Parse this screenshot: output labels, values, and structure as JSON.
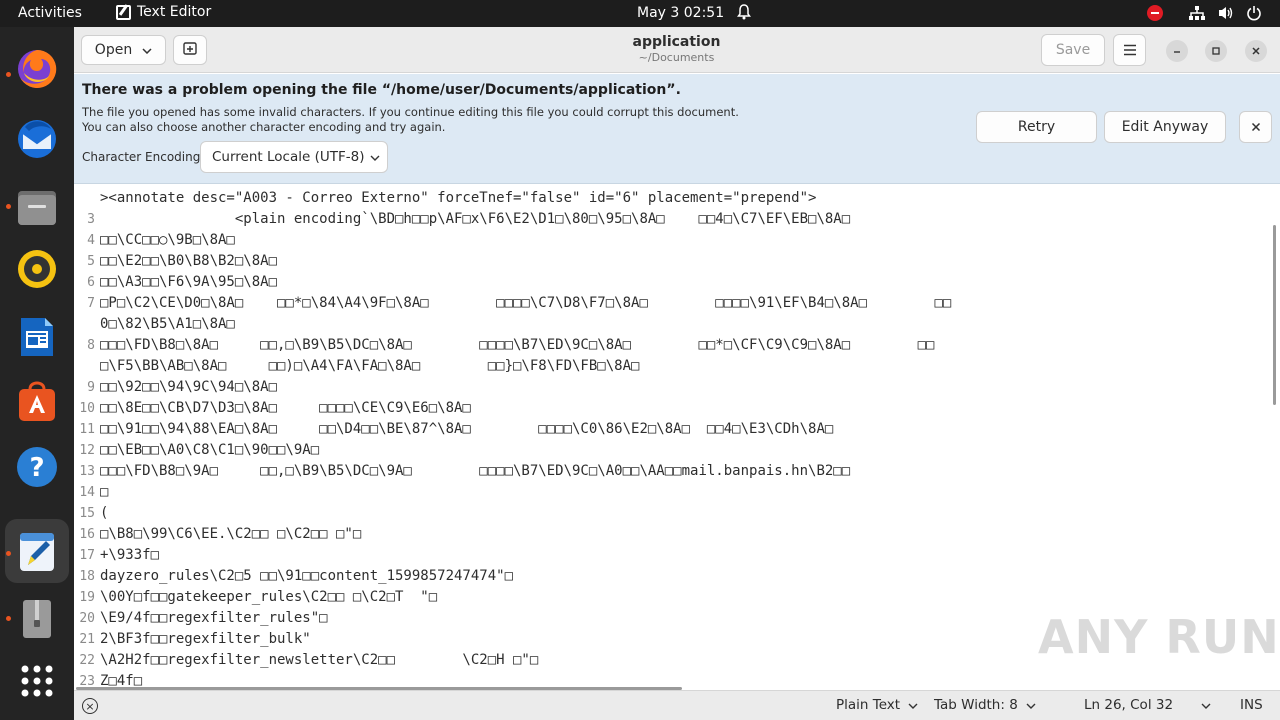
{
  "topbar": {
    "activities": "Activities",
    "app_name": "Text Editor",
    "clock": "May 3  02:51"
  },
  "dock": {
    "items": [
      "firefox",
      "thunderbird",
      "files",
      "rhythmbox",
      "writer",
      "app-center",
      "help",
      "text-editor",
      "archive-manager",
      "show-apps"
    ]
  },
  "window": {
    "title": "application",
    "subtitle": "~/Documents",
    "open_label": "Open",
    "save_label": "Save"
  },
  "infobar": {
    "heading": "There was a problem opening the file “/home/user/Documents/application”.",
    "line1": "The file you opened has some invalid characters. If you continue editing this file you could corrupt this document.",
    "line2": "You can also choose another character encoding and try again.",
    "encoding_label": "Character Encoding:",
    "encoding_value": "Current Locale (UTF-8)",
    "retry_label": "Retry",
    "edit_anyway_label": "Edit Anyway"
  },
  "editor": {
    "lines": [
      {
        "n": "",
        "text": "><annotate desc=\"A003 - Correo Externo\" forceTnef=\"false\" id=\"6\" placement=\"prepend\">"
      },
      {
        "n": "3",
        "text": "                <plain encoding`\\BD□h□□p\\AF□x\\F6\\E2\\D1□\\80□\\95□\\8A□    □□4□\\C7\\EF\\EB□\\8A□"
      },
      {
        "n": "4",
        "text": "□□\\CC□□○\\9B□\\8A□"
      },
      {
        "n": "5",
        "text": "□□\\E2□□\\B0\\B8\\B2□\\8A□"
      },
      {
        "n": "6",
        "text": "□□\\A3□□\\F6\\9A\\95□\\8A□"
      },
      {
        "n": "7",
        "text": "□P□\\C2\\CE\\D0□\\8A□    □□*□\\84\\A4\\9F□\\8A□        □□□□\\C7\\D8\\F7□\\8A□        □□□□\\91\\EF\\B4□\\8A□        □□"
      },
      {
        "n": "",
        "text": "0□\\82\\B5\\A1□\\8A□"
      },
      {
        "n": "8",
        "text": "□□□\\FD\\B8□\\8A□     □□,□\\B9\\B5\\DC□\\8A□        □□□□\\B7\\ED\\9C□\\8A□        □□*□\\CF\\C9\\C9□\\8A□        □□"
      },
      {
        "n": "",
        "text": "□\\F5\\BB\\AB□\\8A□     □□)□\\A4\\FA\\FA□\\8A□        □□}□\\F8\\FD\\FB□\\8A□"
      },
      {
        "n": "9",
        "text": "□□\\92□□\\94\\9C\\94□\\8A□"
      },
      {
        "n": "10",
        "text": "□□\\8E□□\\CB\\D7\\D3□\\8A□     □□□□\\CE\\C9\\E6□\\8A□"
      },
      {
        "n": "11",
        "text": "□□\\91□□\\94\\88\\EA□\\8A□     □□\\D4□□\\BE\\87^\\8A□        □□□□\\C0\\86\\E2□\\8A□  □□4□\\E3\\CDh\\8A□"
      },
      {
        "n": "12",
        "text": "□□\\EB□□\\A0\\C8\\C1□\\90□□\\9A□"
      },
      {
        "n": "13",
        "text": "□□□\\FD\\B8□\\9A□     □□,□\\B9\\B5\\DC□\\9A□        □□□□\\B7\\ED\\9C□\\A0□□\\AA□□mail.banpais.hn\\B2□□"
      },
      {
        "n": "14",
        "text": "□"
      },
      {
        "n": "15",
        "text": "("
      },
      {
        "n": "16",
        "text": "□\\B8□\\99\\C6\\EE.\\C2□□ □\\C2□□ □\"□"
      },
      {
        "n": "17",
        "text": "+\\933f□"
      },
      {
        "n": "18",
        "text": "dayzero_rules\\C2□5 □□\\91□□content_1599857247474\"□"
      },
      {
        "n": "19",
        "text": "\\00Y□f□□gatekeeper_rules\\C2□□ □\\C2□T  \"□"
      },
      {
        "n": "20",
        "text": "\\E9/4f□□regexfilter_rules\"□"
      },
      {
        "n": "21",
        "text": "2\\BF3f□□regexfilter_bulk\""
      },
      {
        "n": "22",
        "text": "\\A2H2f□□regexfilter_newsletter\\C2□□        \\C2□H □\"□"
      },
      {
        "n": "23",
        "text": "Z□4f□"
      }
    ]
  },
  "statusbar": {
    "language": "Plain Text",
    "tab_width": "Tab Width: 8",
    "position": "Ln 26, Col 32",
    "mode": "INS"
  },
  "watermark": "ANY RUN"
}
